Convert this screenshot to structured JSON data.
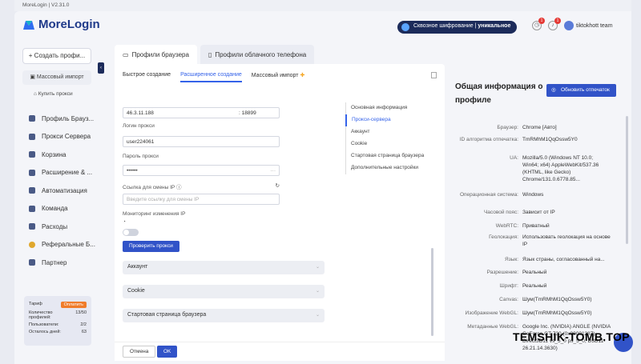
{
  "window": {
    "title": "MoreLogin | V2.31.0"
  },
  "header": {
    "brand": "MoreLogin",
    "encryption_pre": "Сквозное шифрование",
    "encryption_sep": " | ",
    "encryption_bold": "уникальное",
    "notif_count_1": "1",
    "notif_count_2": "1",
    "user_name": "tiktokhott team"
  },
  "sidebar": {
    "create_label": "+ Создать профи...",
    "mass_import": "Массовый импорт",
    "buy_proxy": "Купить прокси",
    "items": [
      {
        "label": "Профиль Брауз..."
      },
      {
        "label": "Прокси Сервера"
      },
      {
        "label": "Корзина"
      },
      {
        "label": "Расширение & ..."
      },
      {
        "label": "Автоматизация"
      },
      {
        "label": "Команда"
      },
      {
        "label": "Расходы"
      },
      {
        "label": "Реферальные Б..."
      },
      {
        "label": "Партнер"
      }
    ],
    "plan": {
      "tariff_label": "Тариф",
      "pay_label": "Оплатить",
      "profiles_label": "Количество профилей:",
      "profiles_value": "13/50",
      "users_label": "Пользователи:",
      "users_value": "2/2",
      "days_label": "Осталось дней:",
      "days_value": "63"
    }
  },
  "tabs": [
    {
      "label": "Профили браузера"
    },
    {
      "label": "Профили облачного телефона"
    }
  ],
  "subtabs": [
    {
      "label": "Быстрое создание"
    },
    {
      "label": "Расширенное создание"
    },
    {
      "label": "Массовый импорт"
    }
  ],
  "form": {
    "host": "46.3.11.188",
    "port": ": 18899",
    "login_label": "Логин прокси",
    "login_value": "user224061",
    "password_label": "Пароль прокси",
    "password_value": "••••••",
    "ip_link_label": "Ссылка для смены IP",
    "ip_link_placeholder": "Введите ссылку для смены IP",
    "monitor_label": "Мониторинг изменения IP",
    "check_btn": "Проверить прокси"
  },
  "sections": [
    {
      "label": "Аккаунт"
    },
    {
      "label": "Cookie"
    },
    {
      "label": "Стартовая страница браузера"
    }
  ],
  "anchors": [
    {
      "label": "Основная информация"
    },
    {
      "label": "Прокси-сервера"
    },
    {
      "label": "Аккаунт"
    },
    {
      "label": "Cookie"
    },
    {
      "label": "Стартовая страница браузера"
    },
    {
      "label": "Дополнительные настройки"
    }
  ],
  "footer": {
    "cancel": "Отмена",
    "ok": "OK"
  },
  "overview": {
    "title": "Общая информация о профиле",
    "refresh": "Обновить отпечаток",
    "rows": [
      {
        "k": "Браузер:",
        "v": "Chrome [Авто]"
      },
      {
        "k": "ID алгоритма отпечатка:",
        "v": "TmRMhM1QqOssw5Y0"
      },
      {
        "k": "UA:",
        "v": "Mozilla/5.0 (Windows NT 10.0; Win64; x64) AppleWebKit/537.36 (KHTML, like Gecko) Chrome/131.0.6778.85..."
      },
      {
        "k": "Операционная система:",
        "v": "Windows"
      },
      {
        "k": "Часовой пояс:",
        "v": "Зависит от IP"
      },
      {
        "k": "WebRTC:",
        "v": "Приватный"
      },
      {
        "k": "Геолокация:",
        "v": "Использовать геолокация на основе IP"
      },
      {
        "k": "Язык:",
        "v": "Язык страны, согласованный на..."
      },
      {
        "k": "Разрешение:",
        "v": "Реальный"
      },
      {
        "k": "Шрифт:",
        "v": "Реальный"
      },
      {
        "k": "Canvas:",
        "v": "Шум(TmRMhM1QqOssw5Y0)"
      },
      {
        "k": "Изображение WebGL:",
        "v": "Шум(TmRMhM1QqOssw5Y0)"
      },
      {
        "k": "Метаданные WebGL:",
        "v": "Google Inc. (NVIDIA) ANGLE (NVIDIA GeForce GT 730 (0x00001287) Direct3D11 vs_5_0 ps_5_0, D3D11-26.21.14.3630)"
      }
    ]
  },
  "watermark": "TEMSHIK-TOMB.TOP"
}
